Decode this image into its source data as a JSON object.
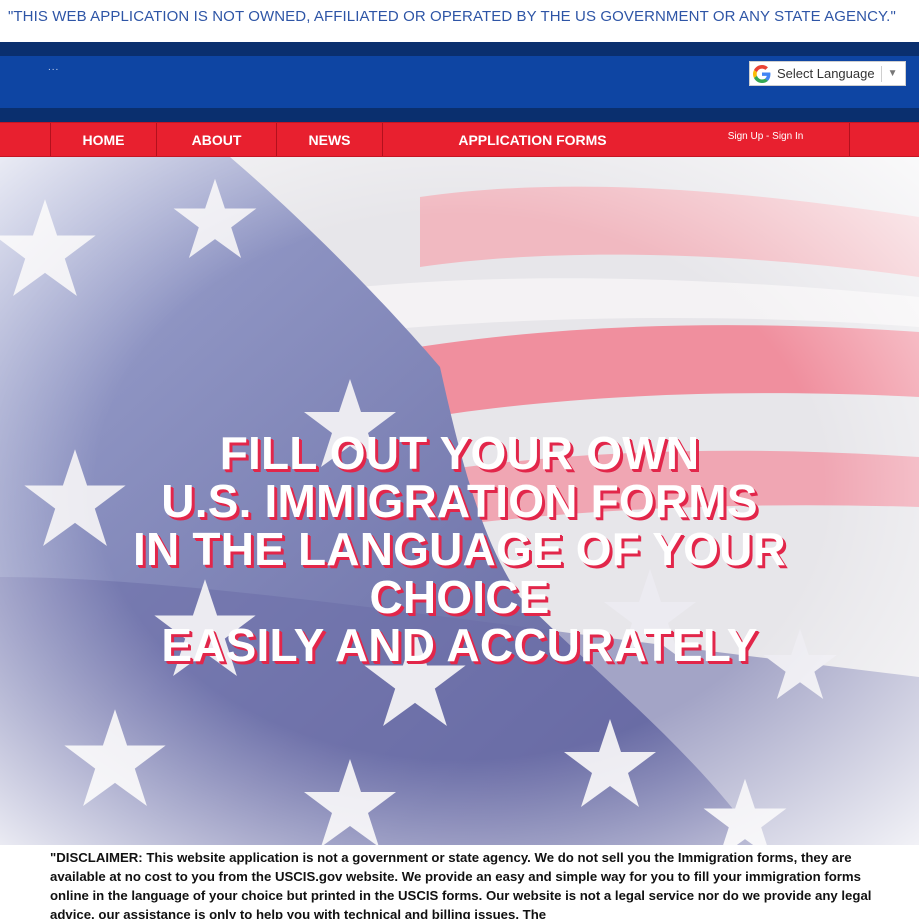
{
  "notice": {
    "text": "\"THIS WEB APPLICATION IS NOT OWNED, AFFILIATED OR OPERATED BY THE US GOVERNMENT OR ANY STATE AGENCY.\""
  },
  "header": {
    "dots": "...",
    "translate": {
      "label": "Select Language",
      "icon": "google-icon",
      "arrow": "▼"
    }
  },
  "nav": {
    "items": [
      {
        "label": "HOME"
      },
      {
        "label": "ABOUT"
      },
      {
        "label": "NEWS"
      },
      {
        "label": "APPLICATION FORMS"
      },
      {
        "label": "Sign Up - Sign In"
      }
    ]
  },
  "hero": {
    "lines": [
      "FILL OUT YOUR OWN",
      "U.S. IMMIGRATION FORMS",
      "IN THE LANGUAGE OF YOUR",
      "CHOICE",
      "EASILY AND ACCURATELY"
    ]
  },
  "disclaimer": {
    "text": "\"DISCLAIMER: This website application is not a government or state agency. We do not sell you the Immigration forms, they are available at no cost to you from the USCIS.gov website. We provide an easy and simple way for you to fill your immigration forms online in the language of your choice but printed in the USCIS forms. Our website is not a legal service nor do we provide any legal advice, our assistance is only to help you with technical and billing issues. The"
  },
  "colors": {
    "notice_text": "#2e55a6",
    "header_blue": "#0e45a3",
    "nav_red": "#e8202f",
    "hero_text_shadow": "#e2264a"
  }
}
